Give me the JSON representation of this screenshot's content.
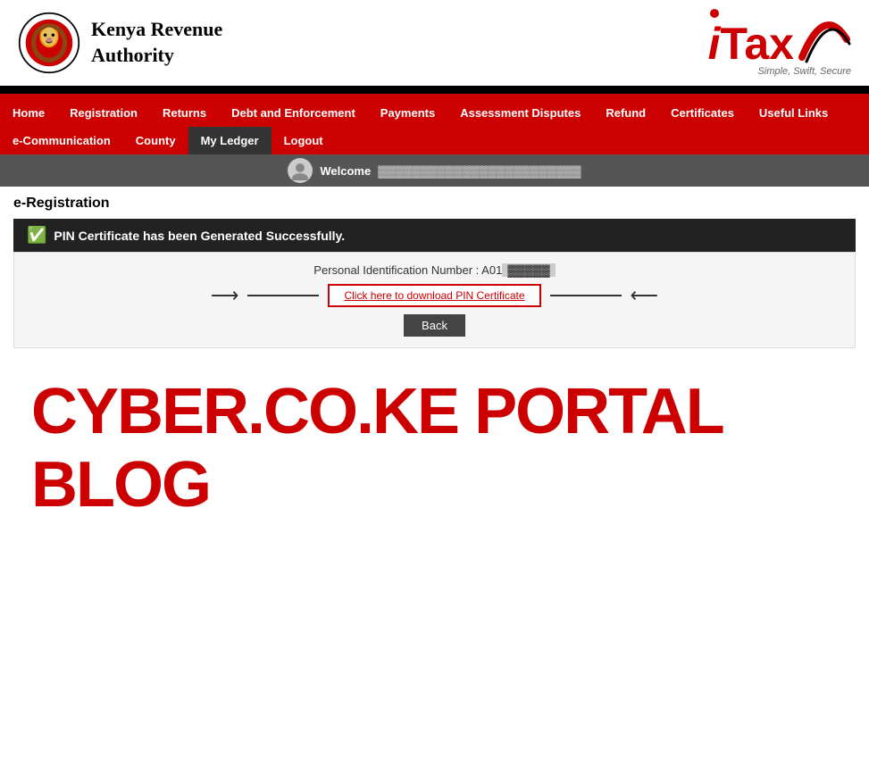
{
  "header": {
    "org_name_line1": "Kenya Revenue",
    "org_name_line2": "Authority",
    "itax_label": "iTax",
    "tagline": "Simple, Swift, Secure"
  },
  "nav": {
    "row1": [
      {
        "label": "Home",
        "id": "home"
      },
      {
        "label": "Registration",
        "id": "registration"
      },
      {
        "label": "Returns",
        "id": "returns"
      },
      {
        "label": "Debt and Enforcement",
        "id": "debt"
      },
      {
        "label": "Payments",
        "id": "payments"
      },
      {
        "label": "Assessment Disputes",
        "id": "assessment"
      },
      {
        "label": "Refund",
        "id": "refund"
      },
      {
        "label": "Certificates",
        "id": "certificates"
      },
      {
        "label": "Useful Links",
        "id": "useful"
      }
    ],
    "row2": [
      {
        "label": "e-Communication",
        "id": "ecomm"
      },
      {
        "label": "County",
        "id": "county"
      },
      {
        "label": "My Ledger",
        "id": "ledger"
      },
      {
        "label": "Logout",
        "id": "logout"
      }
    ]
  },
  "welcome": {
    "label": "Welcome",
    "user_name": "▓▓▓▓▓▓▓▓▓▓"
  },
  "page": {
    "title": "e-Registration",
    "success_message": "PIN Certificate has been Generated Successfully.",
    "pin_label": "Personal Identification Number : A01",
    "pin_value": "▓▓▓▓▓",
    "download_link_text": "Click here to download PIN Certificate",
    "back_button": "Back"
  },
  "watermark": {
    "text": "CYBER.CO.KE PORTAL BLOG"
  }
}
